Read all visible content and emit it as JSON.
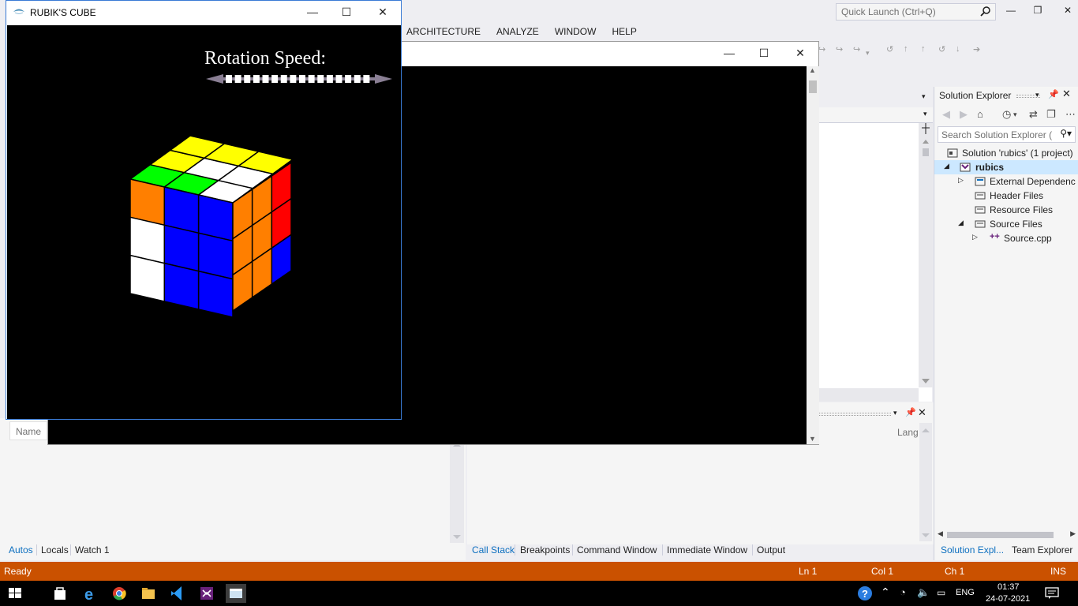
{
  "vs": {
    "quick_launch_placeholder": "Quick Launch (Ctrl+Q)",
    "menu": [
      "ARCHITECTURE",
      "ANALYZE",
      "WINDOW",
      "HELP"
    ]
  },
  "solution_explorer": {
    "title": "Solution Explorer",
    "search_placeholder": "Search Solution Explorer (",
    "tree": [
      {
        "label": "Solution 'rubics' (1 project)"
      },
      {
        "label": "rubics"
      },
      {
        "label": "External Dependenc"
      },
      {
        "label": "Header Files"
      },
      {
        "label": "Resource Files"
      },
      {
        "label": "Source Files"
      },
      {
        "label": "Source.cpp"
      }
    ],
    "tabs": [
      "Solution Expl...",
      "Team Explorer"
    ]
  },
  "bottom": {
    "name_col": "Name",
    "lang_col": "Lang",
    "left_tabs": [
      "Autos",
      "Locals",
      "Watch 1"
    ],
    "right_tabs": [
      "Call Stack",
      "Breakpoints",
      "Command Window",
      "Immediate Window",
      "Output"
    ]
  },
  "status": {
    "ready": "Ready",
    "ln": "Ln 1",
    "col": "Col 1",
    "ch": "Ch 1",
    "ins": "INS"
  },
  "taskbar": {
    "lang": "ENG",
    "time": "01:37",
    "date": "24-07-2021"
  },
  "rubik": {
    "window_title": "RUBIK'S CUBE",
    "speed_label": "Rotation Speed:",
    "speed_slider_steps": 16,
    "colors": {
      "yellow": "#ffff00",
      "green": "#00ff00",
      "white": "#ffffff",
      "orange": "#ff7f00",
      "blue": "#0000ff",
      "red": "#ff0000"
    }
  },
  "colors": {
    "status_bar": "#ca5100",
    "accent": "#0e70c0"
  }
}
